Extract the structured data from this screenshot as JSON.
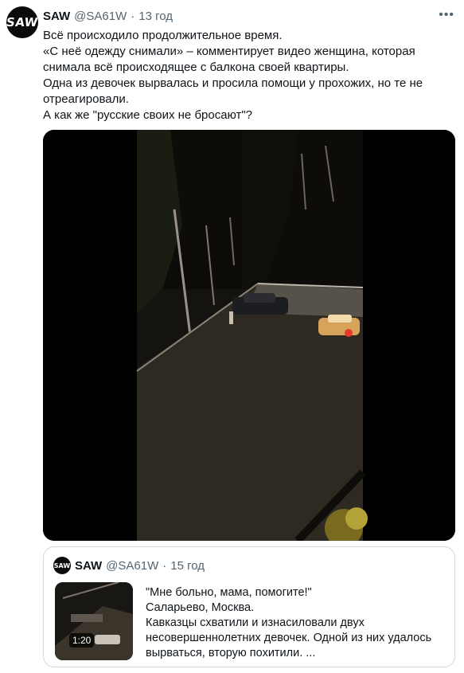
{
  "tweet": {
    "avatar_text": "SAW",
    "name": "SAW",
    "handle": "@SA61W",
    "separator": "·",
    "time": "13 год",
    "more_label": "•••",
    "lines": [
      "Всё происходило продолжительное время.",
      "«С неё одежду снимали» – комментирует видео женщина, которая",
      "снимала всё происходящее с балкона своей квартиры.",
      "Одна из девочек вырвалась и просила помощи у прохожих, но те не",
      "отреагировали.",
      "А как же \"русские своих не бросают\"?"
    ]
  },
  "quote": {
    "avatar_text": "SAW",
    "name": "SAW",
    "handle": "@SA61W",
    "separator": "·",
    "time": "15 год",
    "duration": "1:20",
    "lines": [
      "\"Мне больно, мама, помогите!\"",
      "Саларьево, Москва.",
      "Кавказцы схватили и изнасиловали двух",
      "несовершеннолетних девочек. Одной из них удалось",
      "вырваться, вторую похитили. ..."
    ]
  }
}
